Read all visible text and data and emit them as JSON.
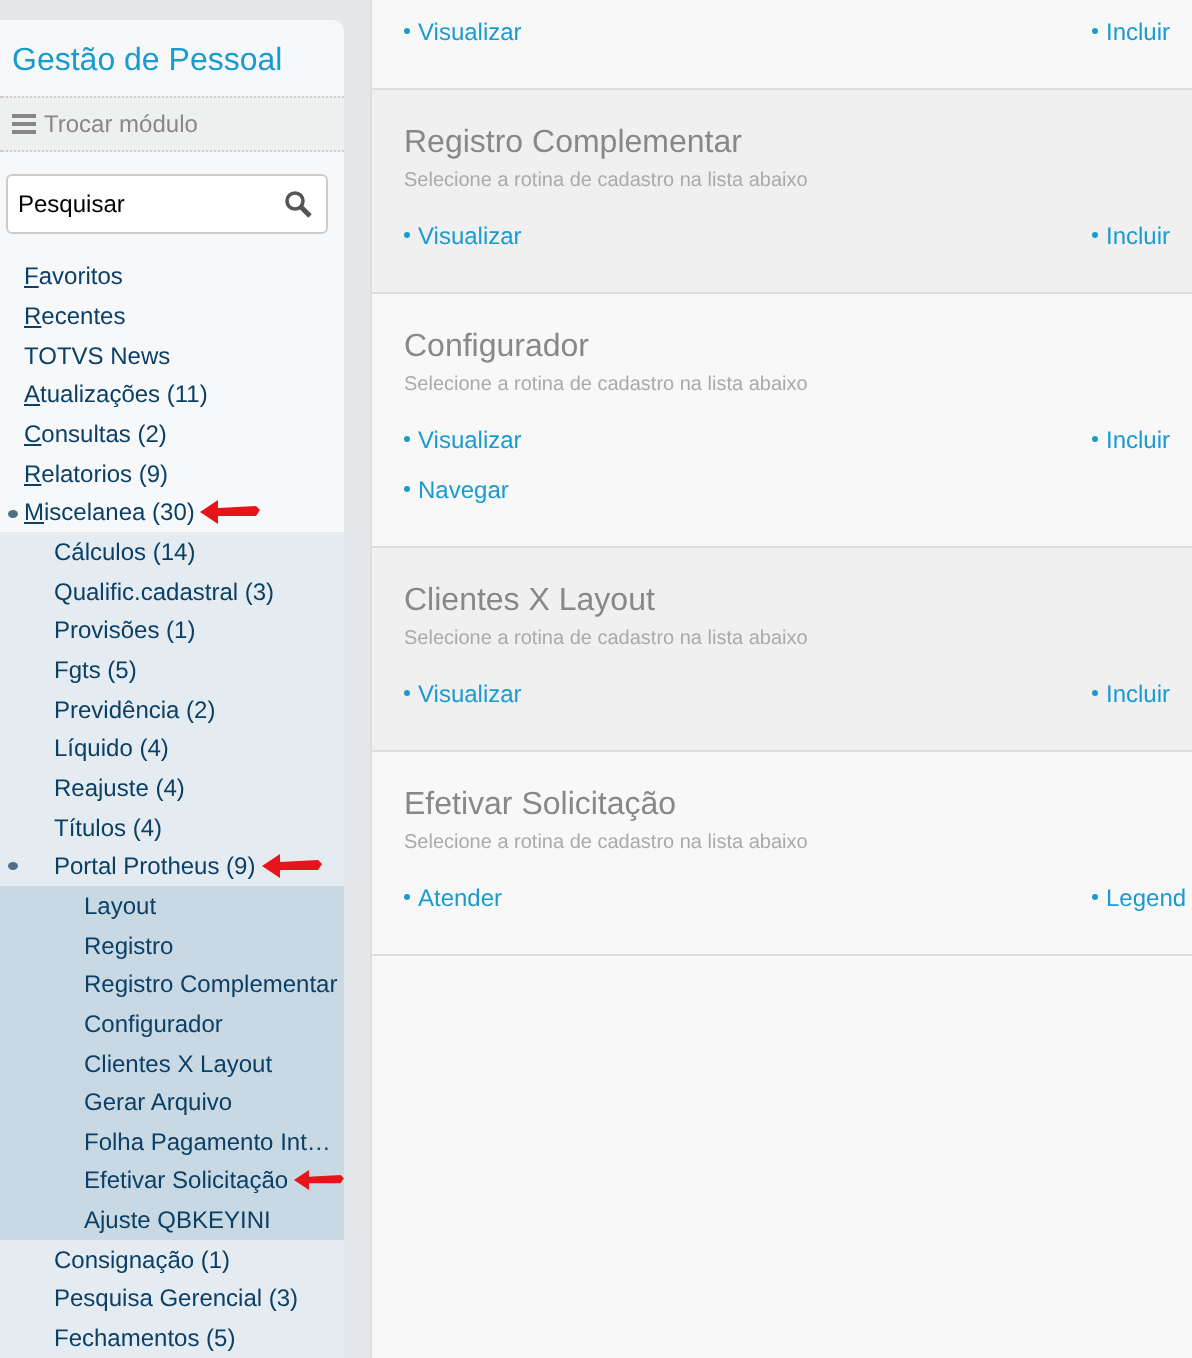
{
  "sidebar": {
    "title": "Gestão de Pessoal",
    "switch_module": "Trocar módulo",
    "search": {
      "value": "Pesquisar"
    },
    "items": [
      {
        "label": "Favoritos",
        "underline_first": true,
        "expanded": false,
        "marked": false
      },
      {
        "label": "Recentes",
        "underline_first": true,
        "expanded": false,
        "marked": false
      },
      {
        "label": "TOTVS News",
        "underline_first": false,
        "expanded": false,
        "marked": false
      },
      {
        "label": "Atualizações (11)",
        "underline_first": true,
        "expanded": false,
        "marked": false
      },
      {
        "label": "Consultas (2)",
        "underline_first": true,
        "expanded": false,
        "marked": false
      },
      {
        "label": "Relatorios (9)",
        "underline_first": true,
        "expanded": false,
        "marked": false
      },
      {
        "label": "Miscelanea (30)",
        "underline_first": true,
        "expanded": true,
        "marked": true,
        "children": [
          {
            "label": "Cálculos (14)",
            "expanded": false,
            "marked": false
          },
          {
            "label": "Qualific.cadastral (3)",
            "expanded": false,
            "marked": false
          },
          {
            "label": "Provisões (1)",
            "expanded": false,
            "marked": false
          },
          {
            "label": "Fgts (5)",
            "expanded": false,
            "marked": false
          },
          {
            "label": "Previdência (2)",
            "expanded": false,
            "marked": false
          },
          {
            "label": "Líquido (4)",
            "expanded": false,
            "marked": false
          },
          {
            "label": "Reajuste (4)",
            "expanded": false,
            "marked": false
          },
          {
            "label": "Títulos (4)",
            "expanded": false,
            "marked": false
          },
          {
            "label": "Portal Protheus (9)",
            "expanded": true,
            "marked": true,
            "children": [
              {
                "label": "Layout",
                "expanded": false,
                "marked": false
              },
              {
                "label": "Registro",
                "expanded": false,
                "marked": false
              },
              {
                "label": "Registro Complementar",
                "expanded": false,
                "marked": false
              },
              {
                "label": "Configurador",
                "expanded": false,
                "marked": false
              },
              {
                "label": "Clientes X Layout",
                "expanded": false,
                "marked": false
              },
              {
                "label": "Gerar Arquivo",
                "expanded": false,
                "marked": false
              },
              {
                "label": "Folha Pagamento Int…",
                "expanded": false,
                "marked": false
              },
              {
                "label": "Efetivar Solicitação",
                "expanded": false,
                "marked": true
              },
              {
                "label": "Ajuste QBKEYINI",
                "expanded": false,
                "marked": false
              }
            ]
          },
          {
            "label": "Consignação (1)",
            "expanded": false,
            "marked": false
          },
          {
            "label": "Pesquisa Gerencial (3)",
            "expanded": false,
            "marked": false
          },
          {
            "label": "Fechamentos (5)",
            "expanded": false,
            "marked": false
          }
        ]
      }
    ]
  },
  "cards": [
    {
      "links_left": [
        "Visualizar"
      ],
      "links_right": [
        "Incluir"
      ]
    },
    {
      "title": "Registro Complementar",
      "subtitle": "Selecione a rotina de cadastro na lista abaixo",
      "links_left": [
        "Visualizar"
      ],
      "links_right": [
        "Incluir"
      ]
    },
    {
      "title": "Configurador",
      "subtitle": "Selecione a rotina de cadastro na lista abaixo",
      "links_left": [
        "Visualizar",
        "Navegar"
      ],
      "links_right": [
        "Incluir"
      ]
    },
    {
      "title": "Clientes X Layout",
      "subtitle": "Selecione a rotina de cadastro na lista abaixo",
      "links_left": [
        "Visualizar"
      ],
      "links_right": [
        "Incluir"
      ]
    },
    {
      "title": "Efetivar Solicitação",
      "subtitle": "Selecione a rotina de cadastro na lista abaixo",
      "links_left": [
        "Atender"
      ],
      "links_right": [
        "Legend"
      ]
    }
  ]
}
